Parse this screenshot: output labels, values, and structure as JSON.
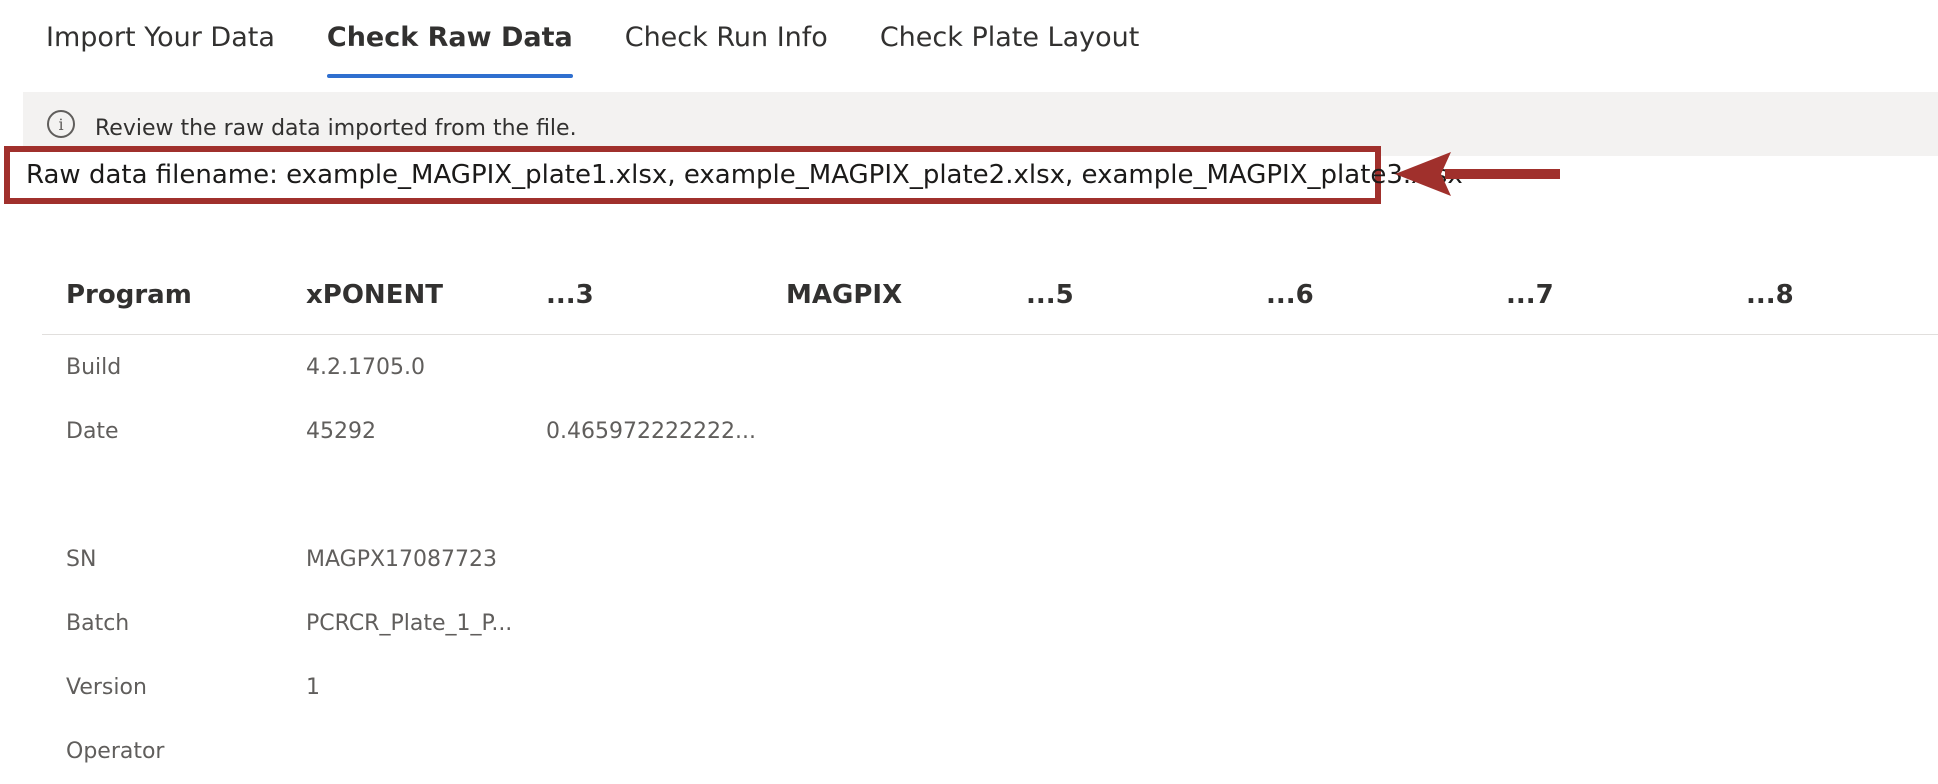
{
  "tabs": [
    {
      "label": "Import Your Data",
      "active": false
    },
    {
      "label": "Check Raw Data",
      "active": true
    },
    {
      "label": "Check Run Info",
      "active": false
    },
    {
      "label": "Check Plate Layout",
      "active": false
    }
  ],
  "info_bar": {
    "icon": "info-icon",
    "text": "Review the raw data imported from the file."
  },
  "filename": {
    "text": "Raw data filename: example_MAGPIX_plate1.xlsx, example_MAGPIX_plate2.xlsx, example_MAGPIX_plate3.xlsx"
  },
  "annotation": {
    "color": "#a0302c"
  },
  "table": {
    "headers": [
      "Program",
      "xPONENT",
      "...3",
      "MAGPIX",
      "...5",
      "...6",
      "...7",
      "...8"
    ],
    "rows": [
      [
        "Build",
        "4.2.1705.0",
        "",
        "",
        "",
        "",
        "",
        ""
      ],
      [
        "Date",
        "45292",
        "0.465972222222...",
        "",
        "",
        "",
        "",
        ""
      ],
      [
        "",
        "",
        "",
        "",
        "",
        "",
        "",
        ""
      ],
      [
        "SN",
        "MAGPX17087723",
        "",
        "",
        "",
        "",
        "",
        ""
      ],
      [
        "Batch",
        "PCRCR_Plate_1_P...",
        "",
        "",
        "",
        "",
        "",
        ""
      ],
      [
        "Version",
        "1",
        "",
        "",
        "",
        "",
        "",
        ""
      ],
      [
        "Operator",
        "",
        "",
        "",
        "",
        "",
        "",
        ""
      ]
    ]
  },
  "colors": {
    "active_tab_underline": "#2f6fcf",
    "info_bar_bg": "#f3f2f1",
    "highlight_border": "#a0302c"
  }
}
